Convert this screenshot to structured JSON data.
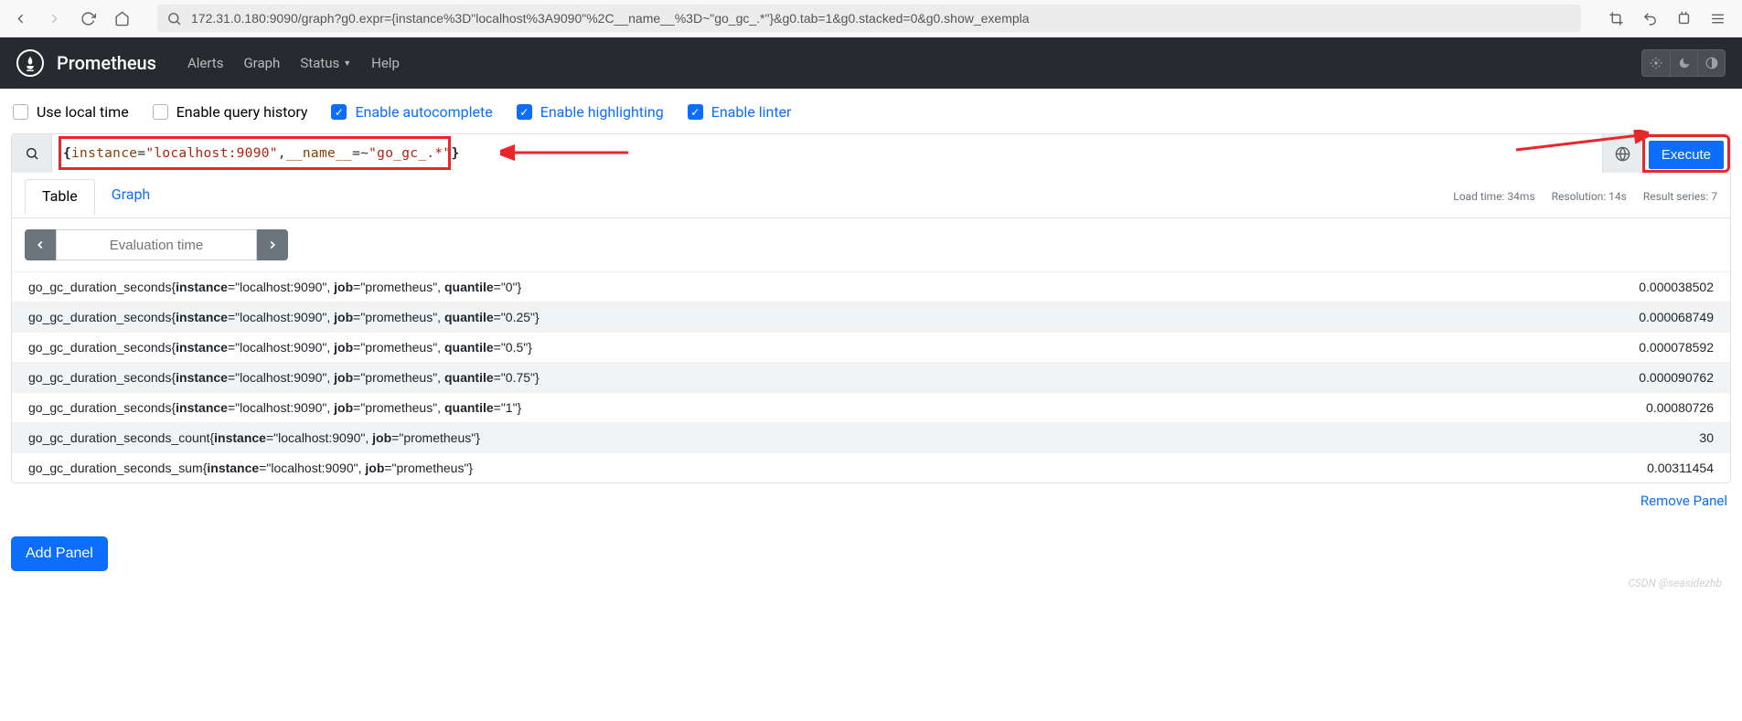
{
  "browser": {
    "url": "172.31.0.180:9090/graph?g0.expr={instance%3D\"localhost%3A9090\"%2C__name__%3D~\"go_gc_.*\"}&g0.tab=1&g0.stacked=0&g0.show_exempla"
  },
  "nav": {
    "brand": "Prometheus",
    "links": [
      "Alerts",
      "Graph",
      "Status",
      "Help"
    ]
  },
  "options": {
    "use_local_time": "Use local time",
    "enable_query_history": "Enable query history",
    "enable_autocomplete": "Enable autocomplete",
    "enable_highlighting": "Enable highlighting",
    "enable_linter": "Enable linter"
  },
  "panel": {
    "expr_raw": "{instance=\"localhost:9090\",__name__=~\"go_gc_.*\"}",
    "execute": "Execute",
    "tabs": {
      "table": "Table",
      "graph": "Graph"
    },
    "meta": {
      "load": "Load time: 34ms",
      "resolution": "Resolution: 14s",
      "series": "Result series: 7"
    },
    "eval_placeholder": "Evaluation time",
    "rows": [
      {
        "name": "go_gc_duration_seconds",
        "labels": [
          [
            "instance",
            "localhost:9090"
          ],
          [
            "job",
            "prometheus"
          ],
          [
            "quantile",
            "0"
          ]
        ],
        "value": "0.000038502"
      },
      {
        "name": "go_gc_duration_seconds",
        "labels": [
          [
            "instance",
            "localhost:9090"
          ],
          [
            "job",
            "prometheus"
          ],
          [
            "quantile",
            "0.25"
          ]
        ],
        "value": "0.000068749"
      },
      {
        "name": "go_gc_duration_seconds",
        "labels": [
          [
            "instance",
            "localhost:9090"
          ],
          [
            "job",
            "prometheus"
          ],
          [
            "quantile",
            "0.5"
          ]
        ],
        "value": "0.000078592"
      },
      {
        "name": "go_gc_duration_seconds",
        "labels": [
          [
            "instance",
            "localhost:9090"
          ],
          [
            "job",
            "prometheus"
          ],
          [
            "quantile",
            "0.75"
          ]
        ],
        "value": "0.000090762"
      },
      {
        "name": "go_gc_duration_seconds",
        "labels": [
          [
            "instance",
            "localhost:9090"
          ],
          [
            "job",
            "prometheus"
          ],
          [
            "quantile",
            "1"
          ]
        ],
        "value": "0.00080726"
      },
      {
        "name": "go_gc_duration_seconds_count",
        "labels": [
          [
            "instance",
            "localhost:9090"
          ],
          [
            "job",
            "prometheus"
          ]
        ],
        "value": "30"
      },
      {
        "name": "go_gc_duration_seconds_sum",
        "labels": [
          [
            "instance",
            "localhost:9090"
          ],
          [
            "job",
            "prometheus"
          ]
        ],
        "value": "0.00311454"
      }
    ],
    "remove": "Remove Panel"
  },
  "add_panel": "Add Panel",
  "watermark": "CSDN @seasidezhb"
}
